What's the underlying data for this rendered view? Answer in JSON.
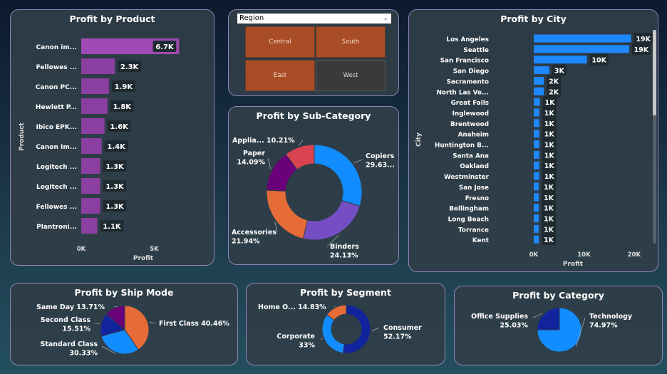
{
  "colors": {
    "bar_product": "#8b3fa0",
    "bar_product_highlight": "#a04bb5",
    "bar_city": "#1e88ff",
    "tile_selected": "#a84d26",
    "tile_unselected": "#3a3a3a"
  },
  "region_slicer": {
    "label": "Region",
    "tiles": [
      {
        "label": "Central",
        "selected": true
      },
      {
        "label": "South",
        "selected": true
      },
      {
        "label": "East",
        "selected": true
      },
      {
        "label": "West",
        "selected": false
      }
    ]
  },
  "chart_data": [
    {
      "id": "product",
      "type": "bar",
      "orientation": "horizontal",
      "title": "Profit by Product",
      "xlabel": "Profit",
      "ylabel": "Product",
      "xlim": [
        0,
        8000
      ],
      "xticks": [
        {
          "value": 0,
          "label": "0K"
        },
        {
          "value": 5000,
          "label": "5K"
        }
      ],
      "categories": [
        "Canon im...",
        "Fellowes ...",
        "Canon PC...",
        "Hewlett P...",
        "Ibico EPK...",
        "Canon Im...",
        "Logitech ...",
        "Logitech ...",
        "Fellowes ...",
        "Plantroni..."
      ],
      "values": [
        6700,
        2300,
        1900,
        1800,
        1600,
        1400,
        1300,
        1300,
        1300,
        1100
      ],
      "labels": [
        "6.7K",
        "2.3K",
        "1.9K",
        "1.8K",
        "1.6K",
        "1.4K",
        "1.3K",
        "1.3K",
        "1.3K",
        "1.1K"
      ]
    },
    {
      "id": "city",
      "type": "bar",
      "orientation": "horizontal",
      "title": "Profit by City",
      "xlabel": "Profit",
      "ylabel": "City",
      "xlim": [
        0,
        22000
      ],
      "xticks": [
        {
          "value": 0,
          "label": "0K"
        },
        {
          "value": 10000,
          "label": "10K"
        },
        {
          "value": 20000,
          "label": "20K"
        }
      ],
      "categories": [
        "Los Angeles",
        "Seattle",
        "San Francisco",
        "San Diego",
        "Sacramento",
        "North Las Ve...",
        "Great Falls",
        "Inglewood",
        "Brentwood",
        "Anaheim",
        "Huntington B...",
        "Santa Ana",
        "Oakland",
        "Westminster",
        "San Jose",
        "Fresno",
        "Bellingham",
        "Long Beach",
        "Torrance",
        "Kent"
      ],
      "values": [
        19400,
        19000,
        10600,
        3100,
        2000,
        2000,
        1200,
        1100,
        1100,
        1100,
        1100,
        1100,
        1100,
        1100,
        1000,
        1000,
        1000,
        1000,
        1000,
        1000
      ],
      "labels": [
        "19K",
        "19K",
        "10K",
        "3K",
        "2K",
        "2K",
        "1K",
        "1K",
        "1K",
        "1K",
        "1K",
        "1K",
        "1K",
        "1K",
        "1K",
        "1K",
        "1K",
        "1K",
        "1K",
        "1K"
      ]
    },
    {
      "id": "subcategory",
      "type": "donut",
      "title": "Profit by Sub-Category",
      "slices": [
        {
          "name": "Copiers",
          "value": 29.63,
          "label_name": "Copiers",
          "label_value": "29.63...",
          "color": "#118dff"
        },
        {
          "name": "Binders",
          "value": 24.13,
          "label_name": "Binders",
          "label_value": "24.13%",
          "color": "#744ec2"
        },
        {
          "name": "Accessories",
          "value": 21.94,
          "label_name": "Accessories",
          "label_value": "21.94%",
          "color": "#e66c37"
        },
        {
          "name": "Paper",
          "value": 14.09,
          "label_name": "Paper",
          "label_value": "14.09%",
          "color": "#6b007b"
        },
        {
          "name": "Appliances",
          "value": 10.21,
          "label_name": "Applia...",
          "label_value": "10.21%",
          "color": "#d9434f"
        }
      ]
    },
    {
      "id": "shipmode",
      "type": "pie",
      "title": "Profit by Ship Mode",
      "slices": [
        {
          "name": "First Class",
          "value": 40.46,
          "label_name": "First Class",
          "label_value": "40.46%",
          "color": "#e66c37"
        },
        {
          "name": "Standard Class",
          "value": 30.33,
          "label_name": "Standard Class",
          "label_value": "30.33%",
          "color": "#118dff"
        },
        {
          "name": "Second Class",
          "value": 15.51,
          "label_name": "Second Class",
          "label_value": "15.51%",
          "color": "#12239e"
        },
        {
          "name": "Same Day",
          "value": 13.71,
          "label_name": "Same Day",
          "label_value": "13.71%",
          "color": "#6b007b"
        }
      ]
    },
    {
      "id": "segment",
      "type": "donut",
      "title": "Profit by Segment",
      "slices": [
        {
          "name": "Consumer",
          "value": 52.17,
          "label_name": "Consumer",
          "label_value": "52.17%",
          "color": "#12239e"
        },
        {
          "name": "Corporate",
          "value": 33,
          "label_name": "Corporate",
          "label_value": "33%",
          "color": "#118dff"
        },
        {
          "name": "Home Office",
          "value": 14.83,
          "label_name": "Home O...",
          "label_value": "14.83%",
          "color": "#e66c37"
        }
      ]
    },
    {
      "id": "category",
      "type": "pie",
      "title": "Profit by Category",
      "slices": [
        {
          "name": "Technology",
          "value": 74.97,
          "label_name": "Technology",
          "label_value": "74.97%",
          "color": "#118dff"
        },
        {
          "name": "Office Supplies",
          "value": 25.03,
          "label_name": "Office Supplies",
          "label_value": "25.03%",
          "color": "#12239e"
        }
      ]
    }
  ]
}
